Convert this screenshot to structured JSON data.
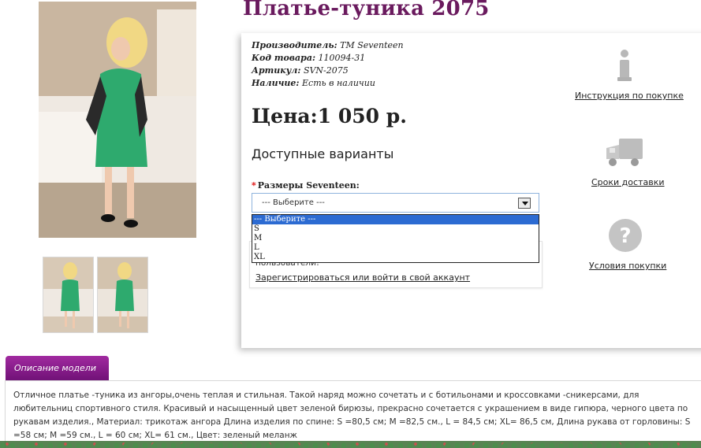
{
  "product": {
    "title": "Платье-туника 2075",
    "details": [
      {
        "label": "Производитель:",
        "value": "TM Seventeen"
      },
      {
        "label": "Код товара:",
        "value": "110094-31"
      },
      {
        "label": "Артикул:",
        "value": "SVN-2075"
      },
      {
        "label": "Наличие:",
        "value": "Есть в наличии"
      }
    ],
    "price": "Цена:1 050 р.",
    "variants_heading": "Доступные варианты",
    "size_label": "Размеры Seventeen:",
    "size_required_mark": "*",
    "size_select": {
      "selected": "--- Выберите ---",
      "options": [
        "--- Выберите ---",
        "S",
        "M",
        "L",
        "XL"
      ]
    }
  },
  "login_notice": {
    "text": "пользователи!",
    "link": "Зарегистрироваться или войти в свой аккаунт"
  },
  "sidebar": [
    {
      "icon": "info-icon",
      "label": "Инструкция по покупке"
    },
    {
      "icon": "delivery-truck-icon",
      "label": "Сроки доставки"
    },
    {
      "icon": "question-icon",
      "label": "Условия покупки"
    }
  ],
  "description": {
    "tab_label": "Описание модели",
    "text": "Отличное платье -туника из ангоры,очень теплая и стильная. Такой наряд можно сочетать и с ботильонами и кроссовками -сникерсами, для любительниц спортивного стиля. Красивый и насыщенный цвет зеленой бирюзы, прекрасно сочетается с украшением в виде гипюра, черного цвета по рукавам изделия., Материал: трикотаж ангора Длина изделия по спине: S =80,5 см; M =82,5 см., L = 84,5 см; XL= 86,5 см, Длина рукава от горловины: S =58 см; M =59 см., L = 60 см; XL= 61 см., Цвет: зеленый меланж"
  },
  "colors": {
    "title": "#6a1a5e",
    "tab": "#8a1f8a",
    "dress": "#2eaa6e",
    "dropdown_selected": "#2c6bd2"
  }
}
